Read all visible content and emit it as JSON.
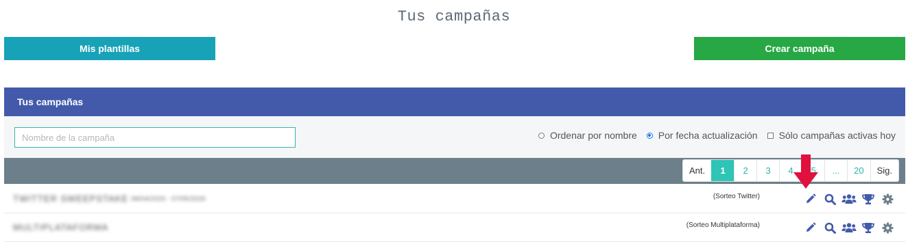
{
  "page": {
    "title": "Tus campañas"
  },
  "top_buttons": {
    "templates_label": "Mis plantillas",
    "create_label": "Crear campaña"
  },
  "panel": {
    "title": "Tus campañas",
    "search": {
      "placeholder": "Nombre de la campaña",
      "value": ""
    },
    "sort_options": [
      {
        "label": "Ordenar por nombre",
        "checked": false
      },
      {
        "label": "Por fecha actualización",
        "checked": true
      }
    ],
    "active_only": {
      "label": "Sólo campañas activas hoy",
      "checked": false
    }
  },
  "pagination": {
    "prev": "Ant.",
    "pages": [
      "1",
      "2",
      "3",
      "4",
      "5",
      "...",
      "20"
    ],
    "active_page": "1",
    "next": "Sig."
  },
  "campaigns": [
    {
      "name": "TWITTER SWEEPSTAKE",
      "meta": "08/04/2020 - 07/05/2020",
      "type": "(Sorteo Twitter)"
    },
    {
      "name": "MULTIPLATAFORMA",
      "meta": "",
      "type": "(Sorteo Multiplataforma)"
    }
  ],
  "row_actions": [
    "pencil-icon",
    "search-icon",
    "users-icon",
    "trophy-icon",
    "gear-icon"
  ],
  "colors": {
    "templates_button": "#17a2b8",
    "create_button": "#28a745",
    "panel_header": "#435aab",
    "pager_bar": "#6c7f8a",
    "active_page": "#2ec4b6",
    "action_icons": "#435aab",
    "annotation_arrow": "#e0103f"
  }
}
